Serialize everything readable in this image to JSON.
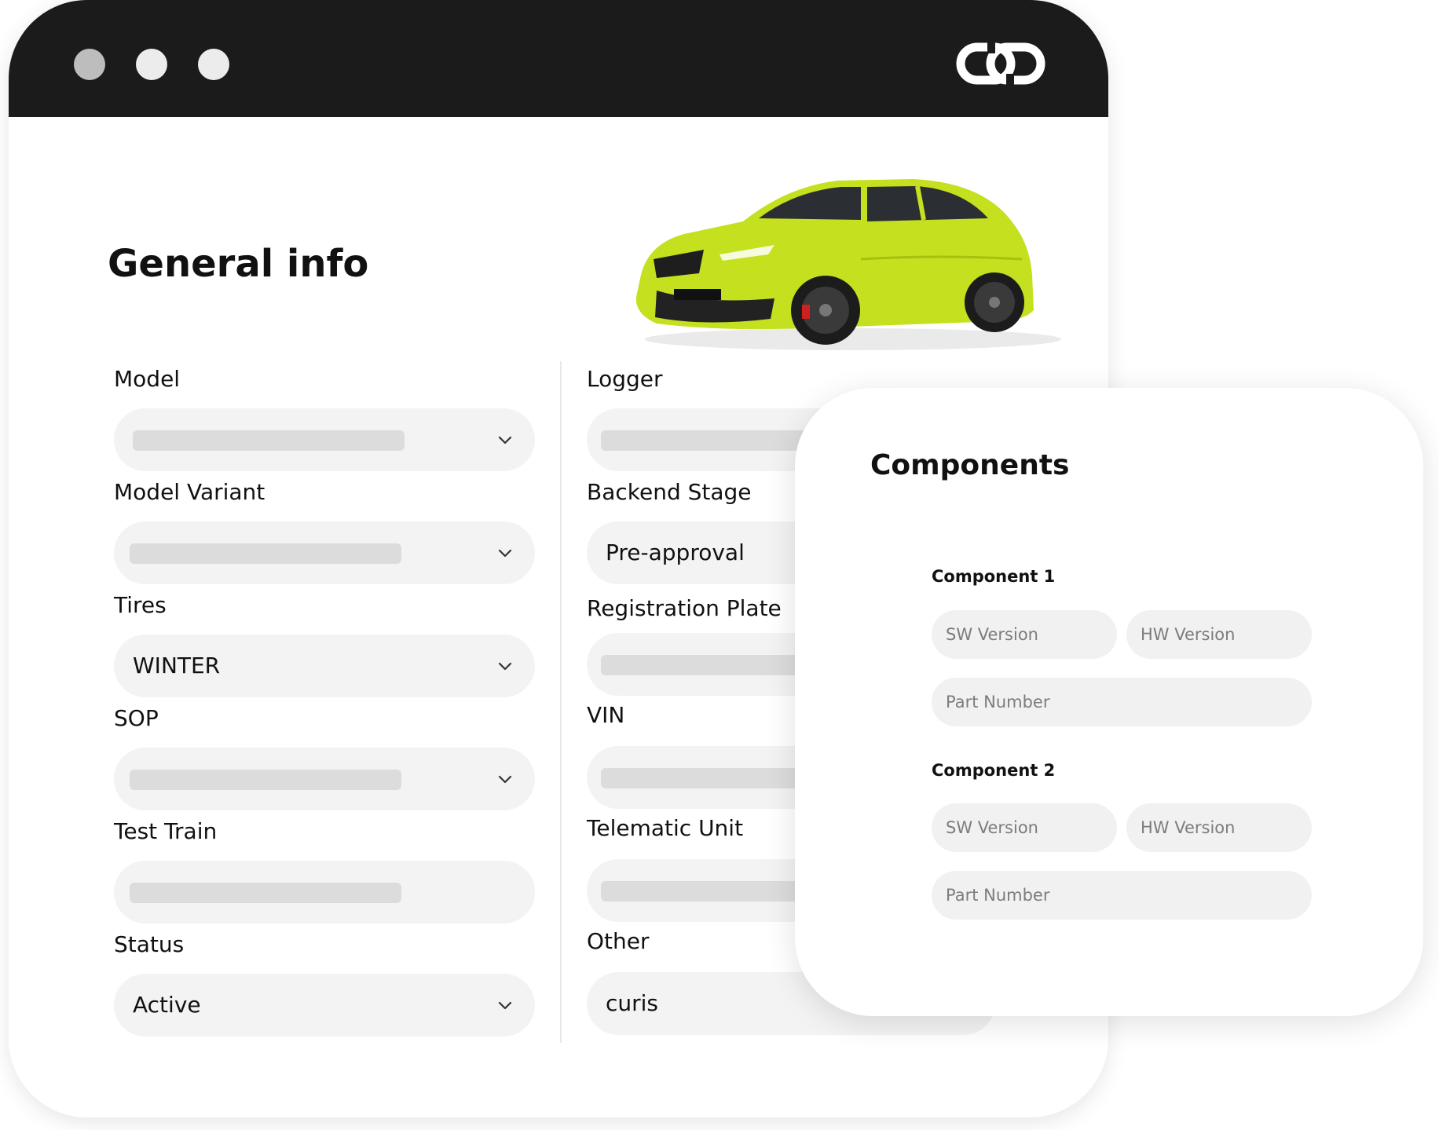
{
  "window": {
    "dots": [
      "window-dot-close",
      "window-dot-minimize",
      "window-dot-maximize"
    ],
    "logo_icon": "chain-link-icon"
  },
  "general": {
    "title": "General info",
    "car_image_icon": "car-image",
    "left_fields": [
      {
        "label": "Model",
        "value": "",
        "type": "select"
      },
      {
        "label": "Model Variant",
        "value": "",
        "type": "select"
      },
      {
        "label": "Tires",
        "value": "WINTER",
        "type": "select"
      },
      {
        "label": "SOP",
        "value": "",
        "type": "select"
      },
      {
        "label": "Test Train",
        "value": "",
        "type": "text"
      },
      {
        "label": "Status",
        "value": "Active",
        "type": "select"
      }
    ],
    "right_fields": [
      {
        "label": "Logger",
        "value": ""
      },
      {
        "label": "Backend Stage",
        "value": "Pre-approval"
      },
      {
        "label": "Registration Plate",
        "value": ""
      },
      {
        "label": "VIN",
        "value": ""
      },
      {
        "label": "Telematic Unit",
        "value": ""
      },
      {
        "label": "Other",
        "value": "curis"
      }
    ]
  },
  "components": {
    "title": "Components",
    "items": [
      {
        "label": "Component 1",
        "sw_placeholder": "SW Version",
        "hw_placeholder": "HW Version",
        "part_placeholder": "Part Number"
      },
      {
        "label": "Component 2",
        "sw_placeholder": "SW Version",
        "hw_placeholder": "HW Version",
        "part_placeholder": "Part Number"
      }
    ]
  },
  "colors": {
    "titlebar": "#1b1b1b",
    "field_bg": "#f3f3f3",
    "skeleton": "#dcdcdc",
    "car_body": "#c4e01e"
  }
}
